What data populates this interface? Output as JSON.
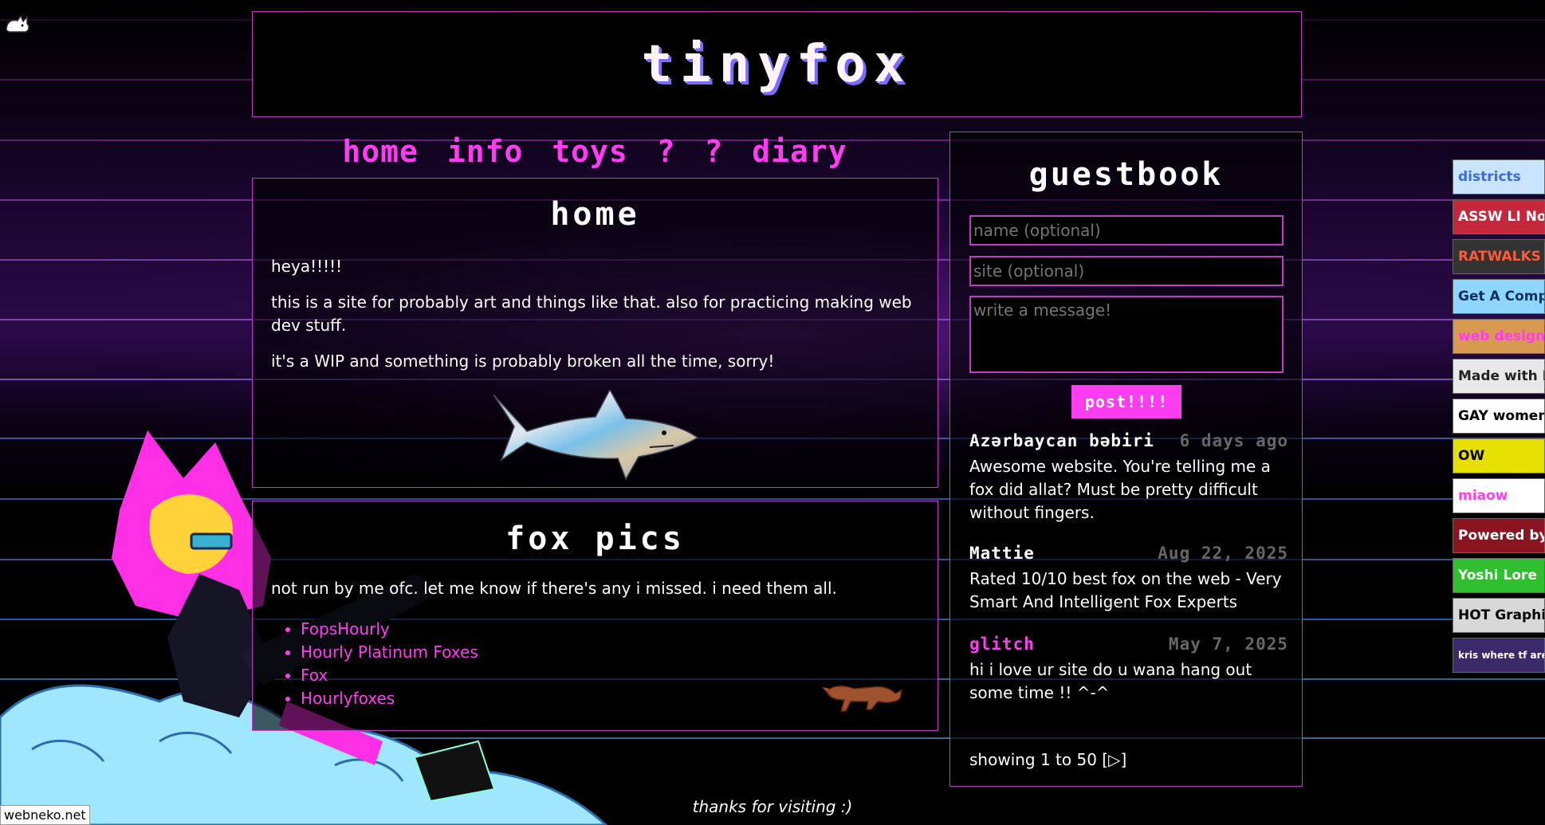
{
  "header": {
    "title": "tinyfox"
  },
  "nav": [
    "home",
    "info",
    "toys",
    "?",
    "?",
    "diary"
  ],
  "home": {
    "title": "home",
    "paragraphs": [
      "heya!!!!!",
      "this is a site for probably art and things like that. also for practicing making web dev stuff.",
      "it's a WIP and something is probably broken all the time, sorry!"
    ]
  },
  "fox_pics": {
    "title": "fox pics",
    "intro": "not run by me ofc. let me know if there's any i missed. i need them all.",
    "links": [
      "FopsHourly",
      "Hourly Platinum Foxes",
      "Fox",
      "Hourlyfoxes"
    ]
  },
  "guestbook": {
    "title": "guestbook",
    "name_placeholder": "name (optional)",
    "site_placeholder": "site (optional)",
    "message_placeholder": "write a message!",
    "post_label": "post!!!!",
    "entries": [
      {
        "name": "Azərbaycan bəbiri",
        "date": "6 days ago",
        "message": "Awesome website. You're telling me a fox did allat? Must be pretty difficult without fingers.",
        "name_color": "#ffffff"
      },
      {
        "name": "Mattie",
        "date": "Aug 22, 2025",
        "message": "Rated 10/10 best fox on the web - Very Smart And Intelligent Fox Experts",
        "name_color": "#ffffff"
      },
      {
        "name": "glitch",
        "date": "May 7, 2025",
        "message": "hi i love ur site do u wana hang out some time !! ^-^",
        "name_color": "#ff3df0"
      }
    ],
    "pager": "showing 1 to 50 [▷]"
  },
  "footer": {
    "thanks": "thanks for visiting :)"
  },
  "badges": [
    {
      "label": "districts",
      "color": "#3b6bd6",
      "bg": "#c9e4ff"
    },
    {
      "label": "ASSW LI Now!",
      "color": "#ffffff",
      "bg": "#c4283a"
    },
    {
      "label": "RATWALKS",
      "color": "#ff5a3a",
      "bg": "#333333"
    },
    {
      "label": "Get A Computer",
      "color": "#103060",
      "bg": "#8fd6ff"
    },
    {
      "label": "web design",
      "color": "#ff3df0",
      "bg": "#d89a50"
    },
    {
      "label": "Made with Neocities",
      "color": "#222222",
      "bg": "#e8e8e8"
    },
    {
      "label": "GAY women",
      "color": "#000000",
      "bg": "#ffffff"
    },
    {
      "label": "OW",
      "color": "#000000",
      "bg": "#e6e000"
    },
    {
      "label": "miaow",
      "color": "#ff3df0",
      "bg": "#ffffff"
    },
    {
      "label": "Powered by Dr Pepper",
      "color": "#ffffff",
      "bg": "#8a1420"
    },
    {
      "label": "Yoshi Lore",
      "color": "#ffffff",
      "bg": "#2fbf2f"
    },
    {
      "label": "HOT Graphics",
      "color": "#000000",
      "bg": "#d8d8d8"
    },
    {
      "label": "kris where tf are we",
      "color": "#ffffff",
      "bg": "#3a2a6a"
    }
  ],
  "webneko": "webneko.net",
  "colors": {
    "accent": "#ff3df0",
    "border": "#c23bc6",
    "title_shadow": "#7b6cff"
  }
}
